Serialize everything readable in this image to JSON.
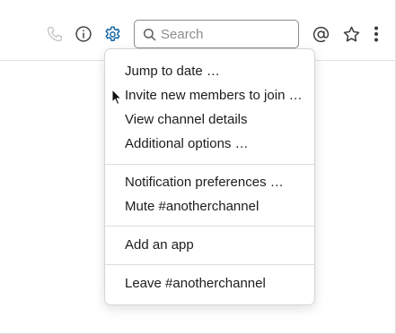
{
  "header": {
    "call_icon": "phone-icon",
    "info_icon": "info-icon",
    "settings_icon": "gear-icon",
    "mentions_icon": "at-sign-icon",
    "starred_icon": "star-icon",
    "more_icon": "more-vertical-icon",
    "accent_color": "#1264a3"
  },
  "search": {
    "placeholder": "Search",
    "value": ""
  },
  "menu": {
    "sections": [
      {
        "items": [
          "Jump to date …",
          "Invite new members to join …",
          "View channel details",
          "Additional options …"
        ]
      },
      {
        "items": [
          "Notification preferences …",
          "Mute #anotherchannel"
        ]
      },
      {
        "items": [
          "Add an app"
        ]
      },
      {
        "items": [
          "Leave #anotherchannel"
        ]
      }
    ]
  }
}
